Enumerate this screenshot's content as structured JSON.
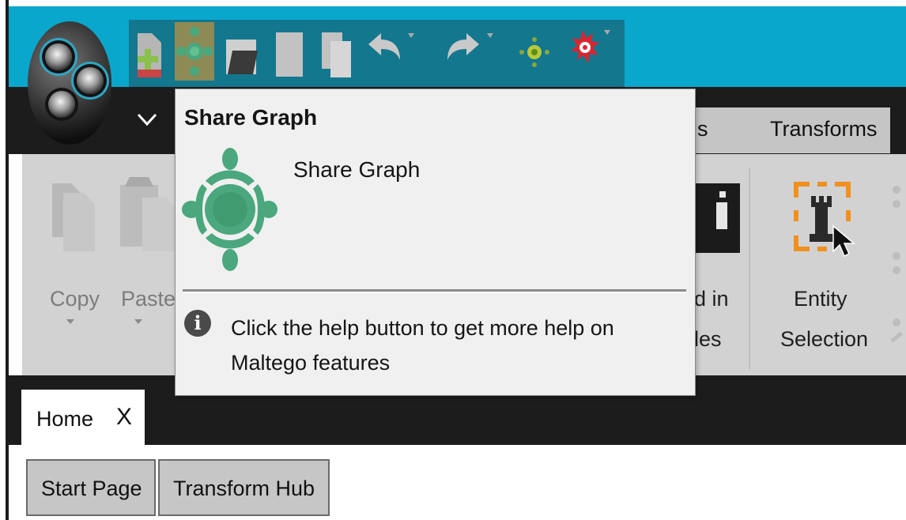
{
  "app": {
    "name": "Maltego"
  },
  "quick_access": {
    "icons": [
      "new-graph-icon",
      "share-graph-icon",
      "open-icon",
      "save-icon",
      "save-all-icon",
      "undo-icon",
      "redo-icon",
      "run-transform-icon",
      "bug-icon"
    ]
  },
  "menu": {
    "tab_partial": "s",
    "tab_transforms": "Transforms"
  },
  "ribbon": {
    "copy": "Copy",
    "paste": "Paste",
    "hidden_line1": "d in",
    "hidden_line2": "les",
    "entity_line1": "Entity",
    "entity_line2": "Selection"
  },
  "tooltip": {
    "title": "Share Graph",
    "name": "Share Graph",
    "help": "Click the help button to get more help on Maltego features",
    "info_glyph": "i"
  },
  "tabs": {
    "home": "Home",
    "close": "X",
    "start_page": "Start Page",
    "transform_hub": "Transform Hub"
  },
  "colors": {
    "title_bar": "#0aa7cd",
    "quick_access_bar": "#13778e",
    "share_green": "#4ba77d",
    "entity_orange": "#f0901e",
    "bug_red": "#d8262f"
  }
}
